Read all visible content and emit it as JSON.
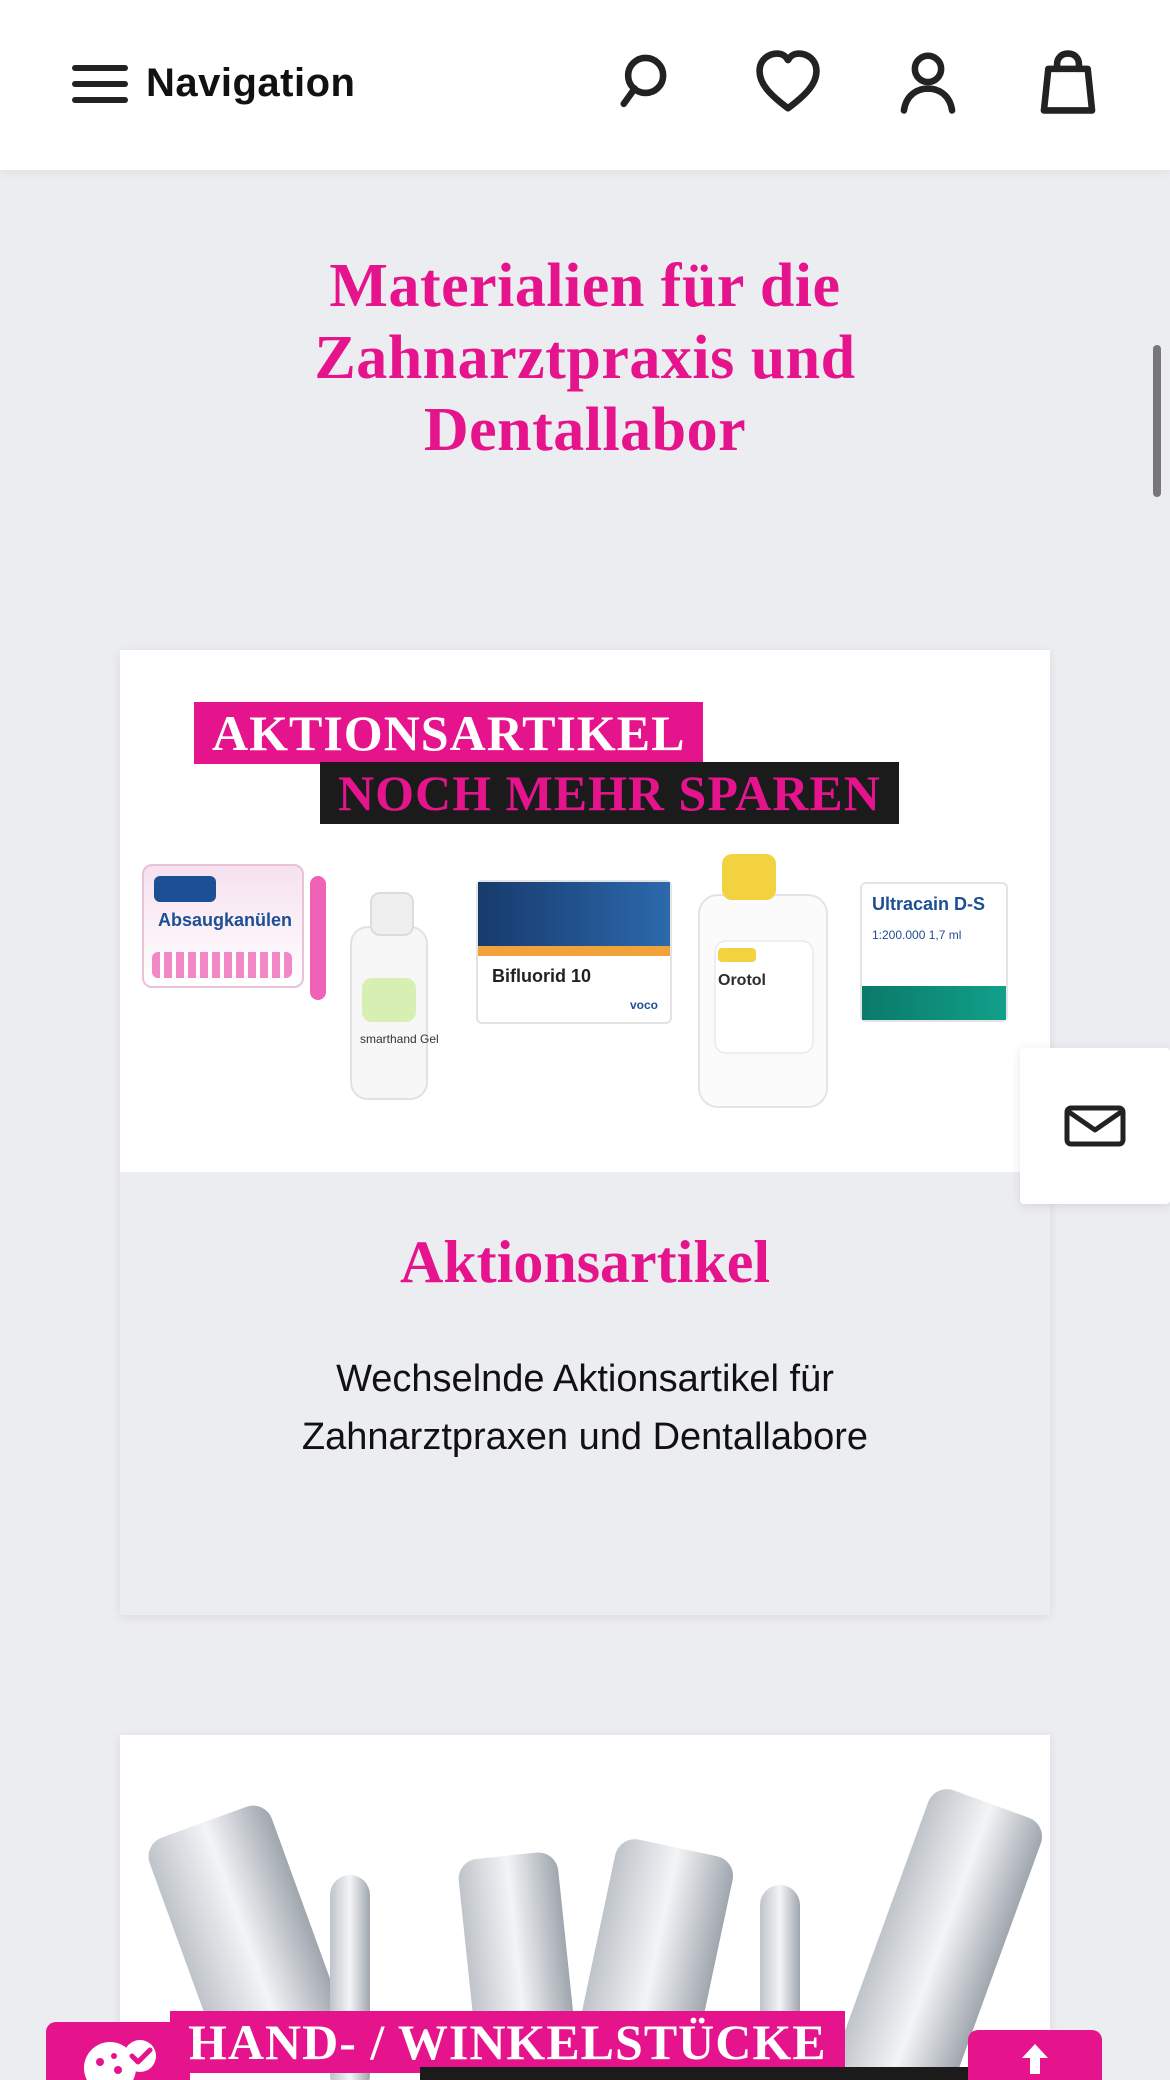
{
  "header": {
    "nav_label": "Navigation",
    "icons": [
      "search-icon",
      "heart-icon",
      "user-icon",
      "shopping-bag-icon"
    ]
  },
  "main": {
    "title_lines": [
      "Materialien für die",
      "Zahnarztpraxis und",
      "Dentallabor"
    ]
  },
  "cards": [
    {
      "banner_line1": "AKTIONSARTIKEL",
      "banner_line2": "NOCH MEHR SPAREN",
      "title": "Aktionsartikel",
      "description_lines": [
        "Wechselnde Aktionsartikel für",
        "Zahnarztpraxen und Dentallabore"
      ],
      "product_labels": {
        "p1": "Absaugkanülen",
        "p2": "smarthand Gel",
        "p3": "Bifluorid 10",
        "p3_brand": "voco",
        "p4": "Orotol",
        "p5": "Ultracain D-S",
        "p5_small": "1:200.000 1,7 ml"
      }
    },
    {
      "banner_line1": "HAND- / WINKELSTÜCKE"
    }
  ],
  "colors": {
    "accent": "#e5148c",
    "background": "#ecedf0"
  },
  "floating": {
    "mail_icon": "mail-icon",
    "cookie_icon": "cookie-settings-icon",
    "to_top_icon": "arrow-up-icon"
  }
}
